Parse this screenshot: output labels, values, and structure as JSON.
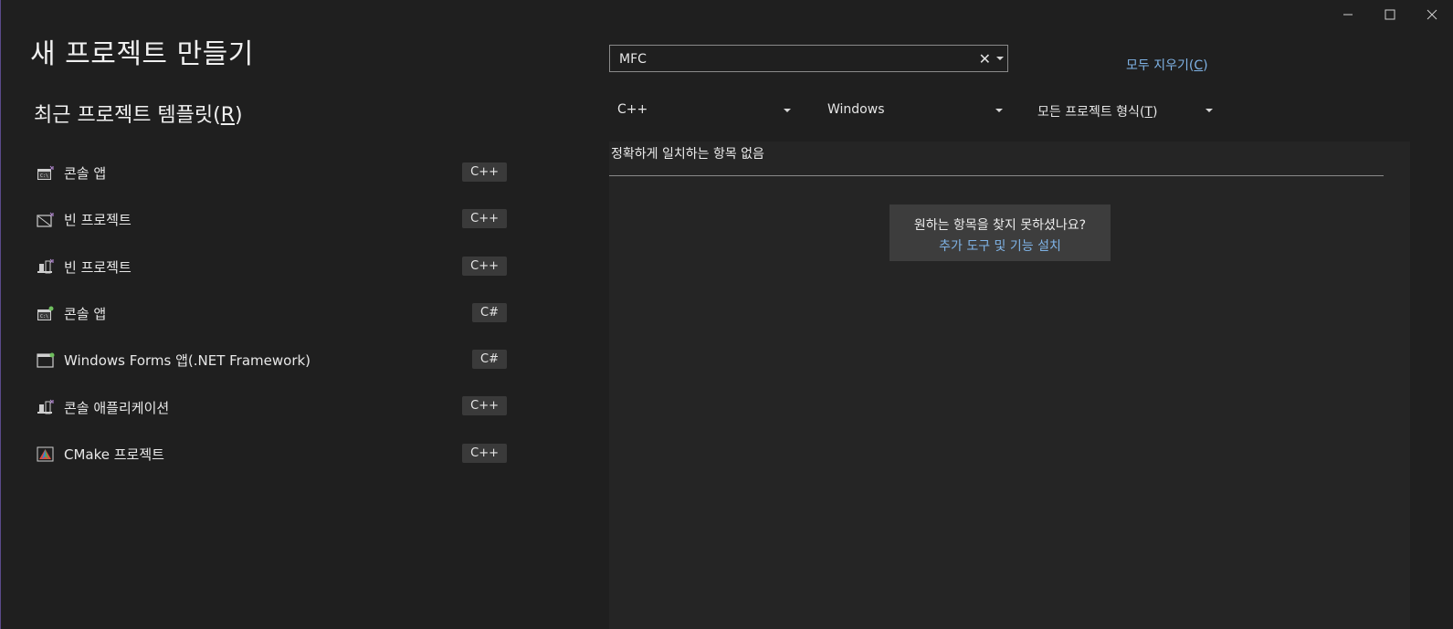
{
  "window": {
    "title": "새 프로젝트 만들기",
    "controls": [
      "minimize-icon",
      "maximize-icon",
      "close-icon"
    ]
  },
  "recent": {
    "heading": "최근 프로젝트 템플릿",
    "heading_accel_open": "(",
    "heading_accel_key": "R",
    "heading_accel_close": ")",
    "items": [
      {
        "name": "콘솔 앱",
        "lang": "C++",
        "icon": "console-app-icon"
      },
      {
        "name": "빈 프로젝트",
        "lang": "C++",
        "icon": "empty-project-icon"
      },
      {
        "name": "빈 프로젝트",
        "lang": "C++",
        "icon": "desktop-project-icon"
      },
      {
        "name": "콘솔 앱",
        "lang": "C#",
        "icon": "console-app-icon"
      },
      {
        "name": "Windows Forms 앱(.NET Framework)",
        "lang": "C#",
        "icon": "windows-forms-icon"
      },
      {
        "name": "콘솔 애플리케이션",
        "lang": "C++",
        "icon": "desktop-project-icon"
      },
      {
        "name": "CMake 프로젝트",
        "lang": "C++",
        "icon": "cmake-icon"
      }
    ]
  },
  "search": {
    "value": "MFC",
    "clear_glyph": "✕"
  },
  "clear_all": {
    "label": "모두 지우기",
    "accel_open": "(",
    "accel_key": "C",
    "accel_close": ")"
  },
  "filters": {
    "language": "C++",
    "platform": "Windows",
    "type_label": "모든 프로젝트 형식",
    "type_accel_open": "(",
    "type_accel_key": "T",
    "type_accel_close": ")"
  },
  "results": {
    "no_match": "정확하게 일치하는 항목 없음",
    "help_question": "원하는 항목을 찾지 못하셨나요?",
    "help_link": "추가 도구 및 기능 설치"
  },
  "colors": {
    "background": "#1f1f1f",
    "panel": "#252525",
    "link": "#7fb3e6",
    "badge": "#3a3a3a"
  }
}
